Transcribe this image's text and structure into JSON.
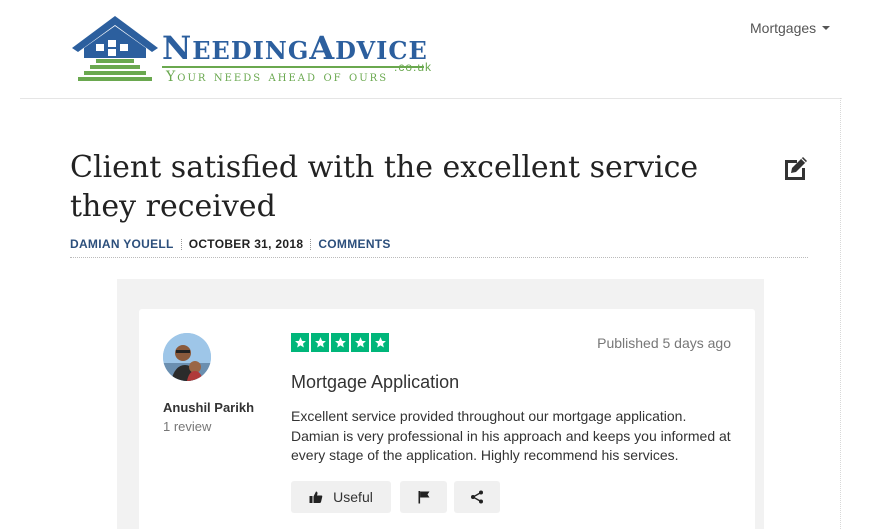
{
  "header": {
    "logo": {
      "word_first": "N",
      "word_rest_1": "EEDING",
      "word_mid": "A",
      "word_rest_2": "DVICE",
      "domain": ".co.uk",
      "tagline": "Your needs ahead of ours"
    },
    "nav": {
      "mortgages_label": "Mortgages"
    }
  },
  "article": {
    "title": "Client satisfied with the excellent service they received",
    "author": "DAMIAN YOUELL",
    "date": "OCTOBER 31, 2018",
    "comments": "COMMENTS"
  },
  "review": {
    "reviewer_name": "Anushil Parikh",
    "reviewer_count": "1 review",
    "rating": 5,
    "rating_max": 5,
    "published": "Published 5 days ago",
    "title": "Mortgage Application",
    "body": "Excellent service provided throughout our mortgage application. Damian is very professional in his approach and keeps you informed at every stage of the application. Highly recommend his services.",
    "useful_label": "Useful",
    "star_color": "#00b67a"
  },
  "colors": {
    "brand_blue": "#2c5f9e",
    "brand_green": "#6aa84f",
    "meta_blue": "#2c4f7c"
  },
  "icons": {
    "edit": "edit-icon",
    "thumbs_up": "thumbs-up-icon",
    "flag": "flag-icon",
    "share": "share-icon",
    "caret": "caret-down-icon"
  }
}
